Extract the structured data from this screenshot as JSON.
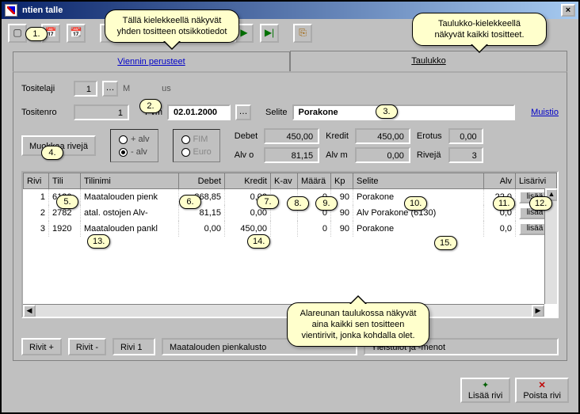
{
  "titlebar": {
    "title_fragment": "ntien talle"
  },
  "callouts": {
    "top_left": "Tällä kielekkeellä näkyvät yhden tositteen otsikkotiedot",
    "top_right": "Taulukko-kielekkeellä näkyvät kaikki tositteet.",
    "bottom": "Alareunan taulukossa näkyvät aina kaikki sen tositteen vientirivit, jonka kohdalla olet."
  },
  "markers": [
    "1.",
    "2.",
    "3.",
    "4.",
    "5.",
    "6.",
    "7.",
    "8.",
    "9.",
    "10.",
    "11.",
    "12.",
    "13.",
    "14.",
    "15."
  ],
  "tabs": {
    "left": "Viennin perusteet",
    "right": "Taulukko"
  },
  "header": {
    "label_tositelaji": "Tositelaji",
    "tositelaji": "1",
    "tositelaji_desc_prefix": "M",
    "tositelaji_desc_suffix": "us",
    "label_tositenro": "Tositenro",
    "tositenro": "1",
    "label_pvm": "Pvm",
    "pvm": "02.01.2000",
    "label_selite": "Selite",
    "selite": "Porakone",
    "muistio": "Muistio"
  },
  "modify_rows_btn": "Muokkaa rivejä",
  "alv_radio": {
    "plus": "+ alv",
    "minus": "- alv"
  },
  "curr_radio": {
    "fim": "FIM",
    "euro": "Euro"
  },
  "totals": {
    "label_debet": "Debet",
    "debet": "450,00",
    "label_kredit": "Kredit",
    "kredit": "450,00",
    "label_erotus": "Erotus",
    "erotus": "0,00",
    "label_alvo": "Alv o",
    "alvo": "81,15",
    "label_alvm": "Alv m",
    "alvm": "0,00",
    "label_riveja": "Rivejä",
    "riveja": "3"
  },
  "grid": {
    "cols": [
      "Rivi",
      "Tili",
      "Tilinimi",
      "Debet",
      "Kredit",
      "K-av",
      "Määrä",
      "Kp",
      "Selite",
      "Alv",
      "Lisärivi"
    ],
    "rows": [
      {
        "rivi": "1",
        "tili": "6130",
        "tilinimi": "Maatalouden pienk",
        "debet": "368,85",
        "kredit": "0,00",
        "kav": "",
        "maara": "0",
        "kp": "90",
        "selite": "Porakone",
        "alv": "22,0",
        "btn": "lisää"
      },
      {
        "rivi": "2",
        "tili": "2782",
        "tilinimi": "atal. ostojen Alv-",
        "debet": "81,15",
        "kredit": "0,00",
        "kav": "",
        "maara": "0",
        "kp": "90",
        "selite": "Alv Porakone (6130)",
        "alv": "0,0",
        "btn": "lisää"
      },
      {
        "rivi": "3",
        "tili": "1920",
        "tilinimi": "Maatalouden pankl",
        "debet": "0,00",
        "kredit": "450,00",
        "kav": "",
        "maara": "0",
        "kp": "90",
        "selite": "Porakone",
        "alv": "0,0",
        "btn": "lisää"
      }
    ]
  },
  "status": {
    "rivit_plus": "Rivit +",
    "rivit_minus": "Rivit -",
    "rivi": "Rivi  1",
    "desc1": "Maatalouden pienkalusto",
    "desc2": "Yleistulot ja -menot"
  },
  "bottom_buttons": {
    "add": "Lisää rivi",
    "del": "Poista rivi"
  }
}
